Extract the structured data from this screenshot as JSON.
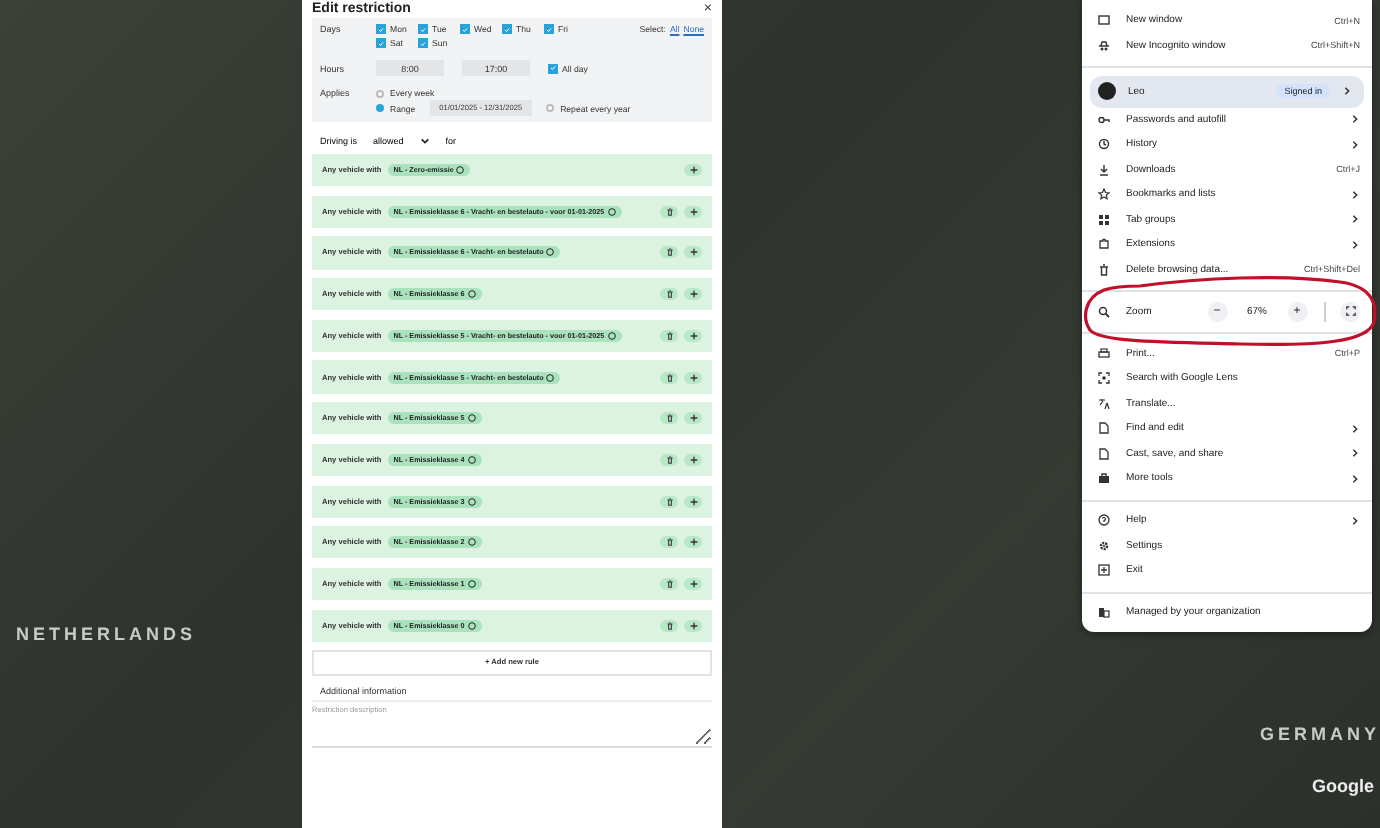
{
  "map": {
    "labels": [
      {
        "text": "NETHERLANDS",
        "kind": "country"
      },
      {
        "text": "GERMANY",
        "kind": "country"
      },
      {
        "text": "Google",
        "kind": "brand"
      }
    ]
  },
  "dialog": {
    "title": "Edit restriction",
    "close": "×",
    "days": {
      "label": "Days",
      "select_label": "Select:",
      "select_links": [
        "All",
        "None"
      ],
      "items": [
        {
          "label": "Mon",
          "checked": true
        },
        {
          "label": "Tue",
          "checked": true
        },
        {
          "label": "Wed",
          "checked": true
        },
        {
          "label": "Thu",
          "checked": true
        },
        {
          "label": "Fri",
          "checked": true
        },
        {
          "label": "Sat",
          "checked": true
        },
        {
          "label": "Sun",
          "checked": true
        }
      ]
    },
    "hours": {
      "label": "Hours",
      "from": "8:00",
      "to": "17:00",
      "all_day": {
        "label": "All day",
        "checked": true
      }
    },
    "applies": {
      "label": "Applies",
      "options": [
        {
          "label": "Every week",
          "selected": false
        },
        {
          "label": "Range",
          "selected": true
        }
      ],
      "range": "01/01/2025 - 12/31/2025",
      "repeat": {
        "label": "Repeat every year",
        "checked": false
      }
    },
    "driving": {
      "label": "Driving is",
      "value": "allowed",
      "suffix": "for"
    },
    "rules": [
      {
        "prefix": "Any vehicle with",
        "chip": "NL - Zero-emissie",
        "deletable": false
      },
      {
        "prefix": "Any vehicle with",
        "chip": "NL - Emissieklasse 6 - Vracht- en bestelauto - voor 01-01-2025",
        "deletable": true
      },
      {
        "prefix": "Any vehicle with",
        "chip": "NL - Emissieklasse 6 - Vracht- en bestelauto",
        "deletable": true
      },
      {
        "prefix": "Any vehicle with",
        "chip": "NL - Emissieklasse 6",
        "deletable": true
      },
      {
        "prefix": "Any vehicle with",
        "chip": "NL - Emissieklasse 5 - Vracht- en bestelauto - voor 01-01-2025",
        "deletable": true
      },
      {
        "prefix": "Any vehicle with",
        "chip": "NL - Emissieklasse 5 - Vracht- en bestelauto",
        "deletable": true
      },
      {
        "prefix": "Any vehicle with",
        "chip": "NL - Emissieklasse 5",
        "deletable": true
      },
      {
        "prefix": "Any vehicle with",
        "chip": "NL - Emissieklasse 4",
        "deletable": true
      },
      {
        "prefix": "Any vehicle with",
        "chip": "NL - Emissieklasse 3",
        "deletable": true
      },
      {
        "prefix": "Any vehicle with",
        "chip": "NL - Emissieklasse 2",
        "deletable": true
      },
      {
        "prefix": "Any vehicle with",
        "chip": "NL - Emissieklasse 1",
        "deletable": true
      },
      {
        "prefix": "Any vehicle with",
        "chip": "NL - Emissieklasse 0",
        "deletable": true
      }
    ],
    "add_rule": "+ Add new rule",
    "additional_label": "Additional information",
    "description_placeholder": "Restriction description"
  },
  "menu": {
    "sections": [
      [
        {
          "kind": "item",
          "label": "New window",
          "shortcut": "Ctrl+N"
        },
        {
          "kind": "item",
          "label": "New Incognito window",
          "shortcut": "Ctrl+Shift+N"
        }
      ],
      [
        {
          "kind": "profile",
          "label": "Leo",
          "badge": "Signed in"
        },
        {
          "kind": "item",
          "label": "Passwords and autofill",
          "submenu": true
        },
        {
          "kind": "item",
          "label": "History",
          "submenu": true
        },
        {
          "kind": "item",
          "label": "Downloads",
          "shortcut": "Ctrl+J"
        },
        {
          "kind": "item",
          "label": "Bookmarks and lists",
          "submenu": true
        },
        {
          "kind": "item",
          "label": "Tab groups",
          "submenu": true
        },
        {
          "kind": "item",
          "label": "Extensions",
          "submenu": true
        },
        {
          "kind": "item",
          "label": "Delete browsing data...",
          "shortcut": "Ctrl+Shift+Del"
        }
      ],
      [
        {
          "kind": "zoom",
          "label": "Zoom",
          "minus": "−",
          "value": "67%",
          "plus": "+"
        }
      ],
      [
        {
          "kind": "item",
          "label": "Print...",
          "shortcut": "Ctrl+P"
        },
        {
          "kind": "item",
          "label": "Search with Google Lens"
        },
        {
          "kind": "item",
          "label": "Translate..."
        },
        {
          "kind": "item",
          "label": "Find and edit",
          "submenu": true
        },
        {
          "kind": "item",
          "label": "Cast, save, and share",
          "submenu": true
        },
        {
          "kind": "item",
          "label": "More tools",
          "submenu": true
        }
      ],
      [
        {
          "kind": "item",
          "label": "Help",
          "submenu": true
        },
        {
          "kind": "item",
          "label": "Settings"
        },
        {
          "kind": "item",
          "label": "Exit"
        }
      ],
      [
        {
          "kind": "item",
          "label": "Managed by your organization"
        }
      ]
    ]
  }
}
